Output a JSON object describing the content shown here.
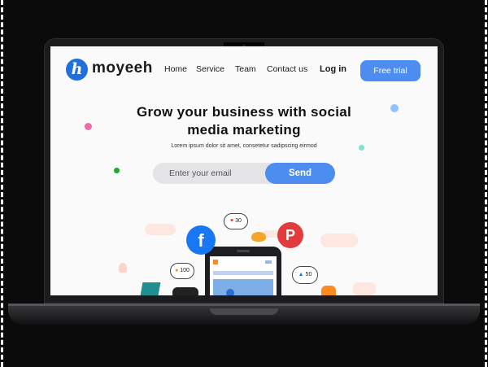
{
  "brand": {
    "name": "moyeeh",
    "logo_letter": "h"
  },
  "nav": {
    "home": "Home",
    "service": "Service",
    "team": "Team",
    "contact": "Contact us",
    "login": "Log in",
    "trial": "Free trial"
  },
  "hero": {
    "title_line1": "Grow your business with social",
    "title_line2": "media marketing",
    "subtitle": "Lorem ipsum dolor sit amet, consetetur sadipscing eirmod"
  },
  "signup": {
    "email_placeholder": "Enter your email",
    "send_label": "Send"
  },
  "illustration": {
    "like_count": "30",
    "follower_count": "100",
    "thumbs_count": "50",
    "facebook_glyph": "f",
    "pinterest_glyph": "P"
  },
  "colors": {
    "accent": "#4d8df0",
    "logo": "#1f6fdc",
    "facebook": "#1877f2",
    "pinterest": "#e23b3b",
    "laptop": "#1b1b1d"
  }
}
